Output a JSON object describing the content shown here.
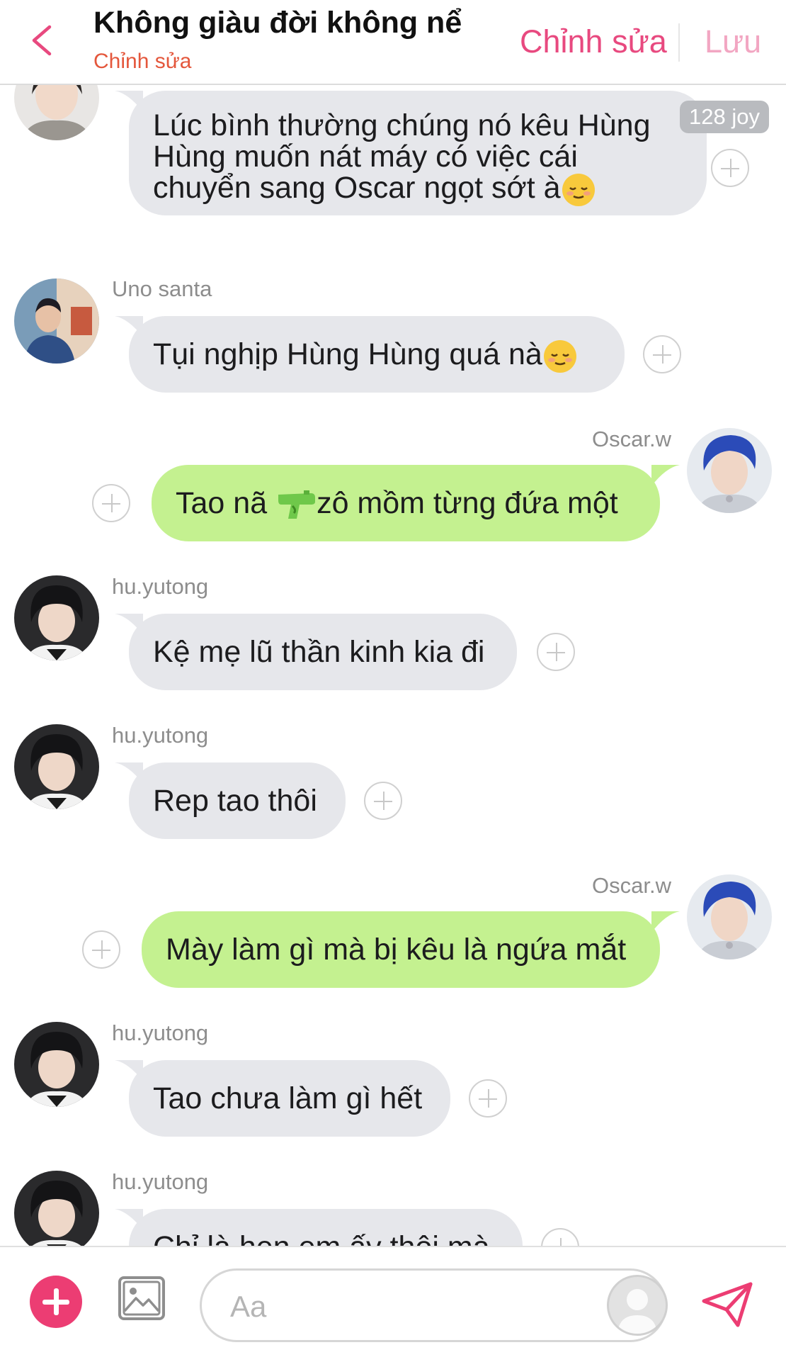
{
  "header": {
    "title": "Không giàu đời không nể",
    "subtitle": "Chỉnh sửa",
    "edit_label": "Chỉnh sửa",
    "save_label": "Lưu"
  },
  "messages": [
    {
      "side": "in",
      "user": "",
      "avatar": "avatar-girl",
      "text_lines": [
        "Lúc bình thường chúng nó kêu Hùng",
        "Hùng muốn nát máy có việc cái",
        "chuyển sang Oscar ngọt sớt à"
      ],
      "emoji": "relieved-face-icon",
      "badge": "128 joy"
    },
    {
      "side": "in",
      "user": "Uno santa",
      "avatar": "avatar-uno",
      "text": "Tụi nghịp Hùng Hùng quá nà",
      "emoji": "relieved-face-icon"
    },
    {
      "side": "out",
      "user": "Oscar.w",
      "avatar": "avatar-oscar",
      "text_before": "Tao nã ",
      "emoji": "water-pistol-icon",
      "text_after": "zô mồm từng đứa một"
    },
    {
      "side": "in",
      "user": "hu.yutong",
      "avatar": "avatar-hu",
      "text": "Kệ mẹ lũ thần kinh kia đi"
    },
    {
      "side": "in",
      "user": "hu.yutong",
      "avatar": "avatar-hu",
      "text": "Rep tao thôi"
    },
    {
      "side": "out",
      "user": "Oscar.w",
      "avatar": "avatar-oscar",
      "text": "Mày làm gì mà bị kêu là ngứa mắt"
    },
    {
      "side": "in",
      "user": "hu.yutong",
      "avatar": "avatar-hu",
      "text": "Tao chưa làm gì hết"
    },
    {
      "side": "in",
      "user": "hu.yutong",
      "avatar": "avatar-hu",
      "text": "Chỉ là hẹn em ấy thôi mà"
    }
  ],
  "composer": {
    "placeholder": "Aa"
  },
  "colors": {
    "accent": "#ec3d73",
    "incoming_bubble": "#e6e7eb",
    "outgoing_bubble": "#c4f190",
    "subtitle": "#e4573c"
  }
}
